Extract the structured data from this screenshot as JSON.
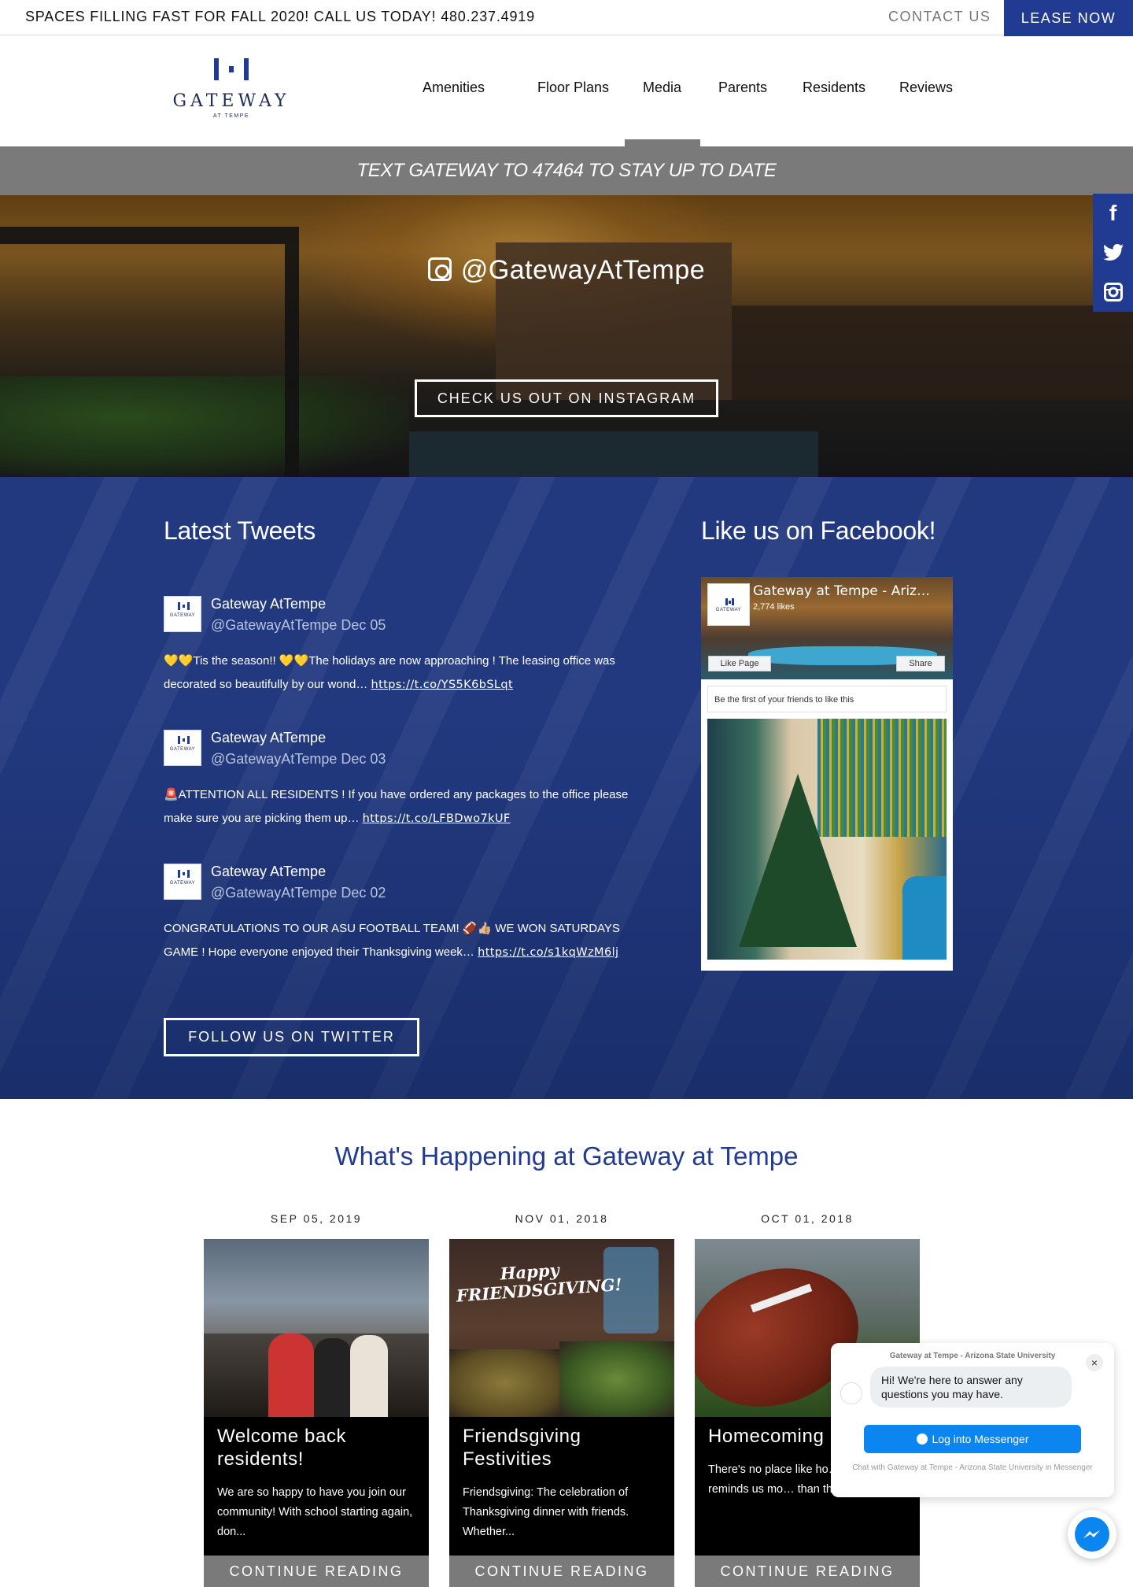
{
  "topbar": {
    "promo": "SPACES FILLING FAST FOR FALL 2020! CALL US TODAY! 480.237.4919",
    "contact": "CONTACT US",
    "lease": "LEASE NOW"
  },
  "logo": {
    "name": "GATEWAY",
    "sub": "AT TEMPE"
  },
  "nav": [
    "Amenities",
    "Floor Plans",
    "Media",
    "Parents",
    "Residents",
    "Reviews"
  ],
  "active_nav": "Media",
  "text_banner": "TEXT GATEWAY TO 47464 TO STAY UP TO DATE",
  "hero": {
    "handle": "@GatewayAtTempe",
    "button": "CHECK US OUT ON INSTAGRAM"
  },
  "social_rail": {
    "facebook": "f",
    "twitter": "twitter-icon",
    "instagram": "instagram-icon"
  },
  "tweets_section": {
    "title": "Latest Tweets",
    "tweets": [
      {
        "name": "Gateway AtTempe",
        "handle_date": "@GatewayAtTempe Dec 05",
        "text": "💛💛Tis the season!! 💛💛The holidays are now approaching ! The leasing office was decorated so beautifully by our wond… ",
        "link": "https://t.co/YS5K6bSLqt"
      },
      {
        "name": "Gateway AtTempe",
        "handle_date": "@GatewayAtTempe Dec 03",
        "text": "🚨ATTENTION ALL RESIDENTS ! If you have ordered any packages to the office please make sure you are picking them up… ",
        "link": "https://t.co/LFBDwo7kUF"
      },
      {
        "name": "Gateway AtTempe",
        "handle_date": "@GatewayAtTempe Dec 02",
        "text": "CONGRATULATIONS TO OUR ASU FOOTBALL TEAM! 🏈👍🏼 WE WON SATURDAYS GAME ! Hope everyone enjoyed their Thanksgiving week… ",
        "link": "https://t.co/s1kqWzM6lj"
      }
    ],
    "follow_button": "FOLLOW US ON TWITTER"
  },
  "facebook": {
    "title": "Like us on Facebook!",
    "page_name": "Gateway at Tempe - Ariz…",
    "likes": "2,774 likes",
    "like_button": "Like Page",
    "share_button": "Share",
    "friends_text": "Be the first of your friends to like this"
  },
  "events": {
    "title": "What's Happening at Gateway at Tempe",
    "cards": [
      {
        "date": "SEP 05, 2019",
        "title": "Welcome back residents!",
        "excerpt": "We are so happy to have you join our community! With school starting again, don...",
        "button": "CONTINUE READING"
      },
      {
        "date": "NOV 01, 2018",
        "title": "Friendsgiving Festivities",
        "excerpt": "Friendsgiving: The celebration of Thanksgiving dinner with friends. Whether...",
        "button": "CONTINUE READING",
        "image_text": "Happy FRIENDSGIVING!"
      },
      {
        "date": "OCT 01, 2018",
        "title": "Homecoming",
        "excerpt": "There's no place like ho… nothing reminds us mo… than the...",
        "button": "CONTINUE READING"
      }
    ]
  },
  "chat": {
    "from": "Gateway at Tempe - Arizona State University",
    "message": "Hi! We're here to answer any questions you may have.",
    "login": "Log into Messenger",
    "footer": "Chat with Gateway at Tempe - Arizona State University in Messenger"
  },
  "colors": {
    "brand": "#213b93",
    "banner_gray": "#7a7a7a",
    "social_bg": "#22397f",
    "messenger": "#0b86f0"
  }
}
